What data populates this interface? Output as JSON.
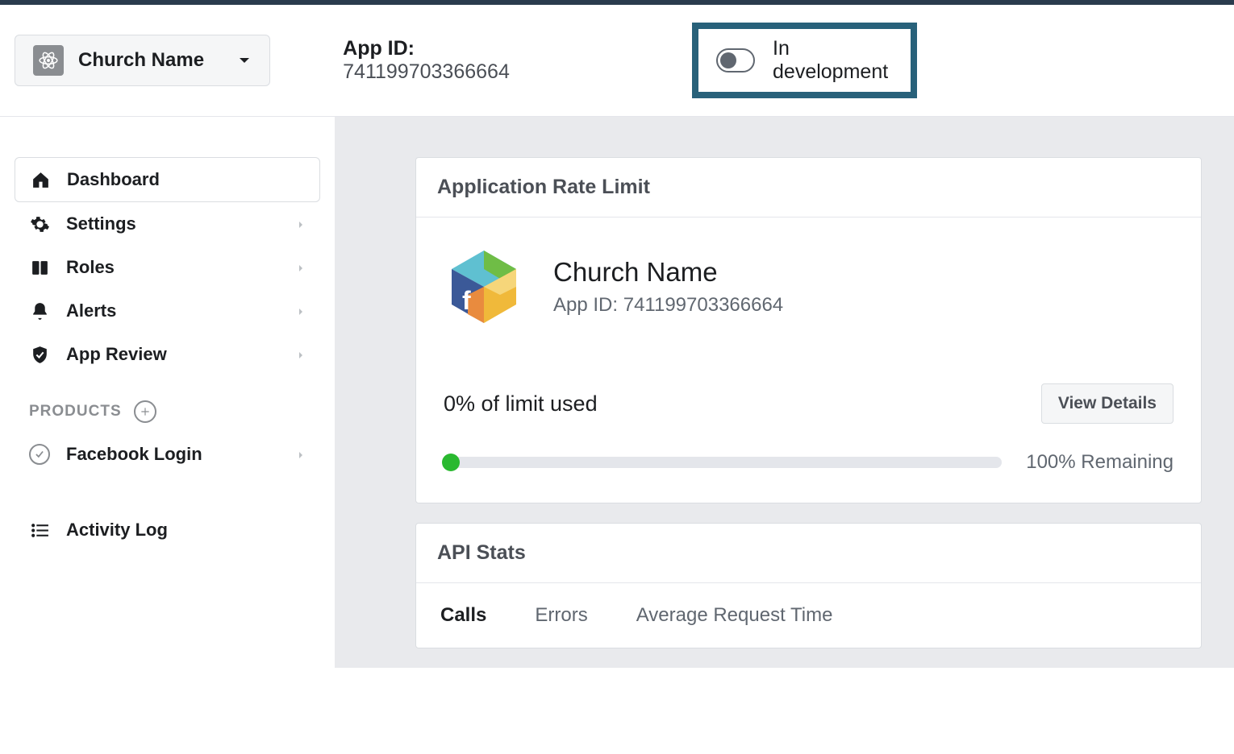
{
  "header": {
    "app_selector_name": "Church Name",
    "app_id_label": "App ID:",
    "app_id_value": "741199703366664",
    "dev_status": "In development"
  },
  "sidebar": {
    "items": [
      {
        "label": "Dashboard",
        "expandable": false,
        "active": true
      },
      {
        "label": "Settings",
        "expandable": true
      },
      {
        "label": "Roles",
        "expandable": true
      },
      {
        "label": "Alerts",
        "expandable": true
      },
      {
        "label": "App Review",
        "expandable": true
      }
    ],
    "products_label": "PRODUCTS",
    "product_items": [
      {
        "label": "Facebook Login",
        "expandable": true
      }
    ],
    "activity_log": "Activity Log"
  },
  "main": {
    "rate_card": {
      "title": "Application Rate Limit",
      "app_name": "Church Name",
      "app_id_label": "App ID:",
      "app_id_value": "741199703366664",
      "limit_used_text": "0% of limit used",
      "view_details": "View Details",
      "remaining_text": "100% Remaining"
    },
    "api_stats": {
      "title": "API Stats",
      "tabs": [
        "Calls",
        "Errors",
        "Average Request Time"
      ]
    }
  }
}
